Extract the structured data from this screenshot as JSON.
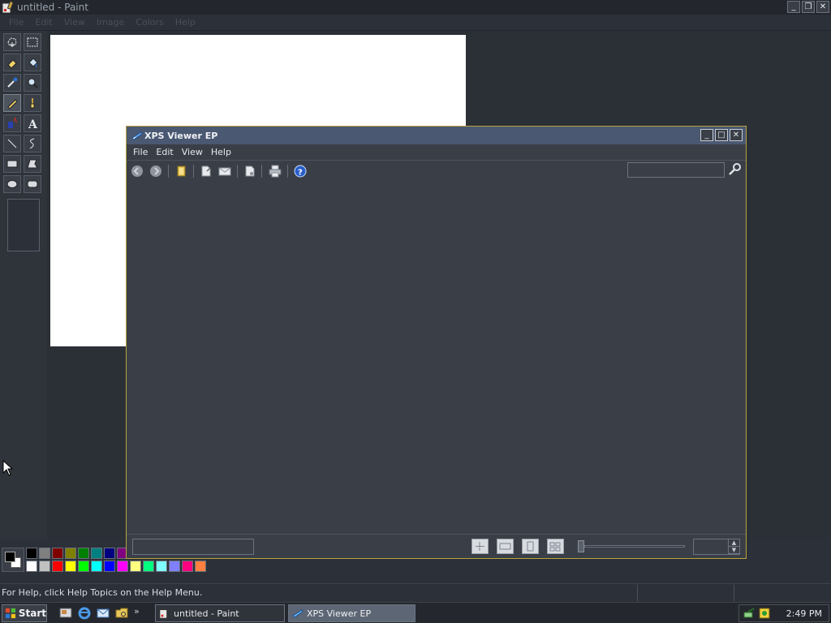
{
  "paint": {
    "title": "untitled - Paint",
    "menu": [
      "File",
      "Edit",
      "View",
      "Image",
      "Colors",
      "Help"
    ],
    "status_text": "For Help, click Help Topics on the Help Menu.",
    "tools": [
      "free-form-select",
      "select",
      "eraser",
      "fill-with-color",
      "pick-color",
      "magnifier",
      "pencil",
      "brush",
      "airbrush",
      "text",
      "line",
      "curve",
      "rectangle",
      "polygon",
      "ellipse",
      "rounded-rectangle"
    ],
    "palette": {
      "row1": [
        "#000000",
        "#808080",
        "#800000",
        "#808000",
        "#008000",
        "#008080",
        "#000080",
        "#800080"
      ],
      "row2": [
        "#ffffff",
        "#c0c0c0",
        "#ff0000",
        "#ffff00",
        "#00ff00",
        "#00ffff",
        "#0000ff",
        "#ff00ff",
        "#ffff80",
        "#00ff80",
        "#80ffff",
        "#8080ff",
        "#ff0080",
        "#ff8040"
      ],
      "foreground": "#000000",
      "background": "#ffffff"
    }
  },
  "xps": {
    "title": "XPS Viewer EP",
    "menu": [
      "File",
      "Edit",
      "View",
      "Help"
    ],
    "search_value": ""
  },
  "taskbar": {
    "start_label": "Start",
    "tasks": [
      "untitled - Paint",
      "XPS Viewer EP"
    ],
    "clock": "2:49 PM"
  }
}
